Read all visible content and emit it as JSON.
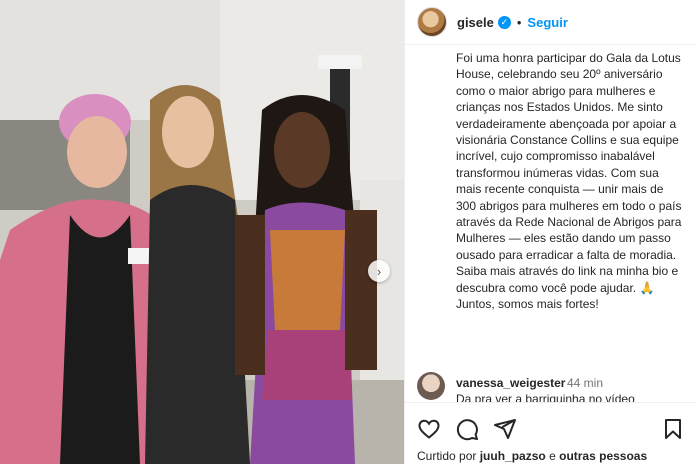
{
  "post": {
    "username": "gisele",
    "separator": "•",
    "follow_label": "Seguir",
    "caption": "Foi uma honra participar do Gala da Lotus House, celebrando seu 20º aniversário como o maior abrigo para mulheres e crianças nos Estados Unidos. Me sinto verdadeiramente abençoada por apoiar a visionária Constance Collins e sua equipe incrível, cujo compromisso inabalável transformou inúmeras vidas. Com sua mais recente conquista — unir mais de 300 abrigos para mulheres em todo o país através da Rede Nacional de Abrigos para Mulheres — eles estão dando um passo ousado para erradicar a falta de moradia. Saiba mais através do link na minha bio e descubra como você pode ajudar. 🙏 Juntos, somos mais fortes!"
  },
  "comment": {
    "username": "vanessa_weigester",
    "time": "44 min",
    "text": "Da pra ver a barriguinha no vídeo"
  },
  "likes": {
    "prefix": "Curtido por",
    "user": "juuh_pazso",
    "connector": "e",
    "others": "outras pessoas"
  },
  "icons": [
    "verified-badge-icon",
    "chevron-right-icon",
    "heart-icon",
    "comment-icon",
    "share-icon",
    "bookmark-icon"
  ],
  "colors": {
    "accent": "#0095f6",
    "text": "#262626",
    "muted": "#737373"
  }
}
